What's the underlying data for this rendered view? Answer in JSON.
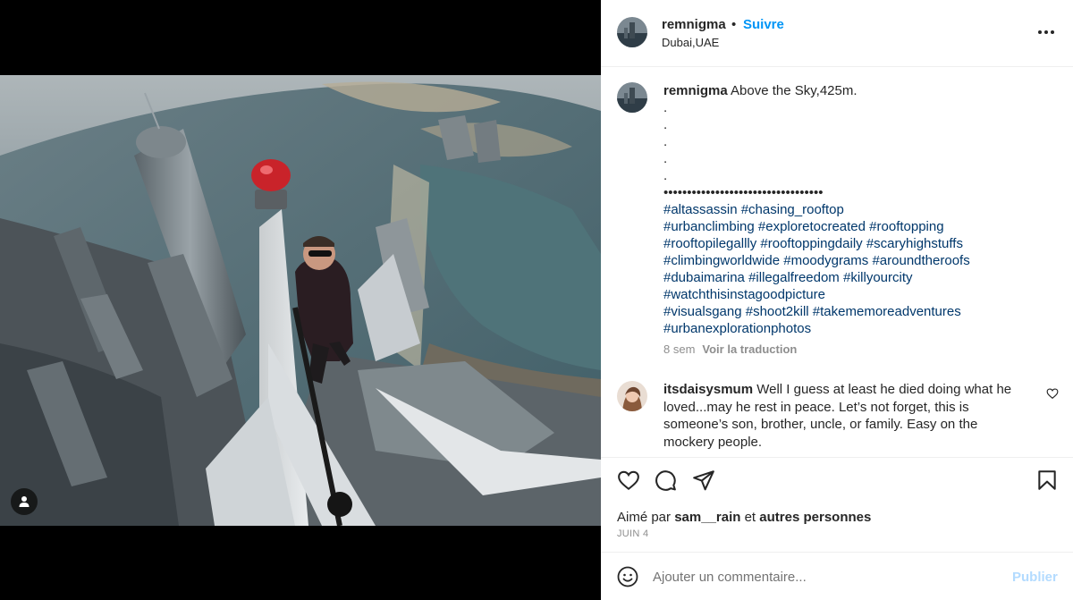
{
  "post": {
    "username": "remnigma",
    "dot": "•",
    "follow_label": "Suivre",
    "location": "Dubai,UAE",
    "more_icon": "more-horizontal-icon",
    "tag_icon": "person-tag-icon"
  },
  "caption": {
    "username": "remnigma",
    "text": "Above the Sky,425m.",
    "dots": [
      ".",
      ".",
      ".",
      ".",
      "."
    ],
    "separator": "••••••••••••••••••••••••••••••••••",
    "hashtag_lines": [
      [
        "#altassassin",
        "#chasing_rooftop"
      ],
      [
        "#urbanclimbing",
        "#exploretocreated",
        "#rooftopping"
      ],
      [
        "#rooftopilegallly",
        "#rooftoppingdaily",
        "#scaryhighstuffs"
      ],
      [
        "#climbingworldwide",
        "#moodygrams",
        "#aroundtheroofs"
      ],
      [
        "#dubaimarina",
        "#illegalfreedom",
        "#killyourcity"
      ],
      [
        "#watchthisinstagoodpicture"
      ],
      [
        "#visualsgang",
        "#shoot2kill",
        "#takememoreadventures"
      ],
      [
        "#urbanexplorationphotos"
      ]
    ],
    "age": "8 sem",
    "translate_label": "Voir la traduction"
  },
  "comment": {
    "username": "itsdaisysmum",
    "text": "Well I guess at least he died doing what he loved...may he rest in peace. Let’s not forget, this is someone’s son, brother, uncle, or family. Easy on the mockery people."
  },
  "actions": {
    "icons": [
      "heart-icon",
      "comment-icon",
      "share-icon",
      "bookmark-icon"
    ]
  },
  "likes": {
    "prefix": "Aimé par",
    "user": "sam__rain",
    "connector": "et",
    "others": "autres personnes"
  },
  "date": "JUIN 4",
  "comment_box": {
    "placeholder": "Ajouter un commentaire...",
    "publish_label": "Publier"
  },
  "colors": {
    "accent": "#0095f6",
    "hashtag": "#00376b",
    "muted": "#8e8e8e",
    "publish_disabled": "#b3dbff"
  }
}
